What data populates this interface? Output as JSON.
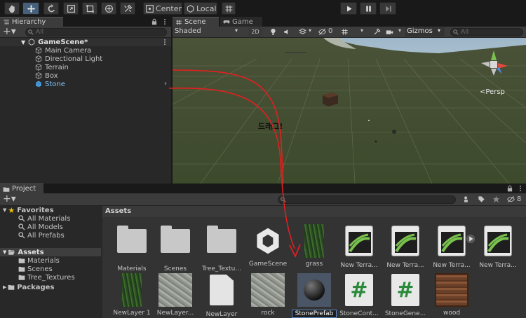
{
  "toolbar": {
    "pivot_label": "Center",
    "space_label": "Local"
  },
  "hierarchy": {
    "tab_label": "Hierarchy",
    "search_placeholder": "All",
    "scene_name": "GameScene*",
    "items": [
      "Main Camera",
      "Directional Light",
      "Terrain",
      "Box",
      "Stone"
    ]
  },
  "scene_view": {
    "tab_scene": "Scene",
    "tab_game": "Game",
    "shading_mode": "Shaded",
    "mode_2d": "2D",
    "hidden_count": "0",
    "gizmos_label": "Gizmos",
    "search_placeholder": "All",
    "persp_label": "<Persp",
    "annotation": "드래그!",
    "annotation_color": "#e02020"
  },
  "project": {
    "tab_label": "Project",
    "favorites_label": "Favorites",
    "favorites": [
      "All Materials",
      "All Models",
      "All Prefabs"
    ],
    "assets_label": "Assets",
    "assets_children": [
      "Materials",
      "Scenes",
      "Tree_Textures"
    ],
    "packages_label": "Packages",
    "breadcrumb": "Assets",
    "hidden_packages_count": "8",
    "row1": [
      "Materials",
      "Scenes",
      "Tree_Textu...",
      "GameScene",
      "grass",
      "New Terra...",
      "New Terra...",
      "New Terra...",
      "New Terra..."
    ],
    "row2": [
      "NewLayer 1",
      "NewLayer...",
      "NewLayer",
      "rock",
      "StonePrefab",
      "StoneCont...",
      "StoneGene...",
      "wood"
    ]
  }
}
